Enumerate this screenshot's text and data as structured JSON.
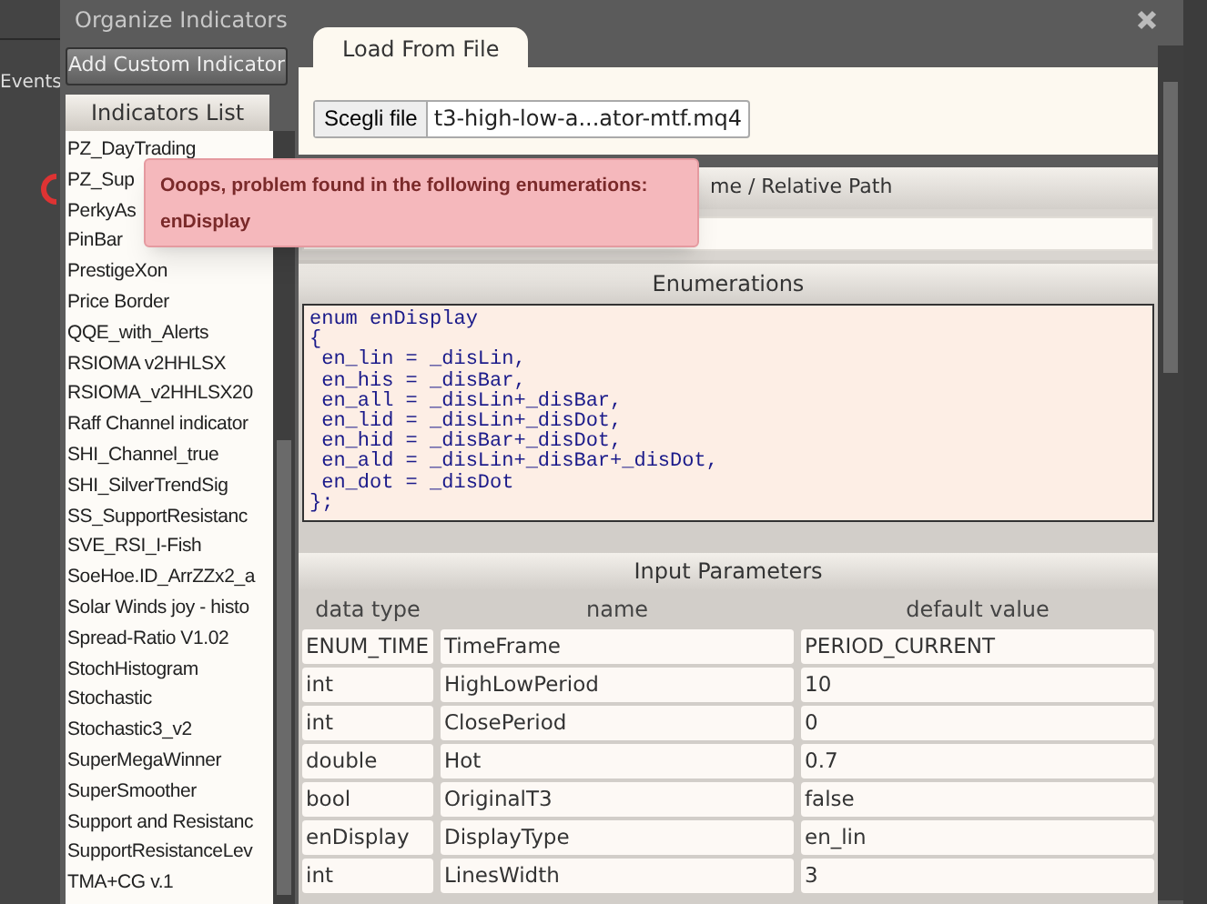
{
  "background": {
    "label": "Events"
  },
  "dialog": {
    "title": "Organize Indicators",
    "add_button": "Add Custom Indicator",
    "indicators_list": {
      "title": "Indicators List",
      "items": [
        {
          "label": "PZ_DayTrading",
          "selected": false
        },
        {
          "label": "PZ_Sup",
          "selected": false
        },
        {
          "label": "PerkyAs",
          "selected": false
        },
        {
          "label": "PinBar",
          "selected": false
        },
        {
          "label": "PrestigeXon",
          "selected": false
        },
        {
          "label": "Price Border",
          "selected": false
        },
        {
          "label": "QQE_with_Alerts",
          "selected": false
        },
        {
          "label": "RSIOMA v2HHLSX",
          "selected": false
        },
        {
          "label": "RSIOMA_v2HHLSX20",
          "selected": false
        },
        {
          "label": "Raff Channel indicator",
          "selected": false
        },
        {
          "label": "SHI_Channel_true",
          "selected": false
        },
        {
          "label": "SHI_SilverTrendSig",
          "selected": false
        },
        {
          "label": "SS_SupportResistanc",
          "selected": false
        },
        {
          "label": "SVE_RSI_I-Fish",
          "selected": false
        },
        {
          "label": "SoeHoe.ID_ArrZZx2_a",
          "selected": false
        },
        {
          "label": "Solar Winds joy - histo",
          "selected": false
        },
        {
          "label": "Spread-Ratio V1.02",
          "selected": false
        },
        {
          "label": "StochHistogram",
          "selected": false
        },
        {
          "label": "Stochastic",
          "selected": false
        },
        {
          "label": "Stochastic3_v2",
          "selected": false
        },
        {
          "label": "SuperMegaWinner",
          "selected": false
        },
        {
          "label": "SuperSmoother",
          "selected": false
        },
        {
          "label": "Support and Resistanc",
          "selected": false
        },
        {
          "label": "SupportResistanceLev",
          "selected": false
        },
        {
          "label": "TMA+CG v.1",
          "selected": false
        }
      ]
    },
    "tabs": [
      {
        "label": "Load From File",
        "selected": true
      }
    ],
    "file_input": {
      "button": "Scegli file",
      "value": "t3-high-low-a...ator-mtf.mq4"
    },
    "name_section": {
      "title": "me / Relative Path"
    },
    "enumerations": {
      "title": "Enumerations",
      "code": [
        "enum enDisplay",
        "{",
        " en_lin = _disLin,",
        " en_his = _disBar,",
        " en_all = _disLin+_disBar,",
        " en_lid = _disLin+_disDot,",
        " en_hid = _disBar+_disDot,",
        " en_ald = _disLin+_disBar+_disDot,",
        " en_dot = _disDot",
        "};"
      ]
    },
    "input_parameters": {
      "title": "Input Parameters",
      "columns": [
        "data type",
        "name",
        "default value"
      ],
      "rows": [
        [
          "ENUM_TIME",
          "TimeFrame",
          "PERIOD_CURRENT"
        ],
        [
          "int",
          "HighLowPeriod",
          "10"
        ],
        [
          "int",
          "ClosePeriod",
          "0"
        ],
        [
          "double",
          "Hot",
          "0.7"
        ],
        [
          "bool",
          "OriginalT3",
          "false"
        ],
        [
          "enDisplay",
          "DisplayType",
          "en_lin"
        ],
        [
          "int",
          "LinesWidth",
          "3"
        ]
      ]
    }
  },
  "error_popup": {
    "title": "Ooops, problem found in the following enumerations:",
    "detail": "enDisplay"
  }
}
